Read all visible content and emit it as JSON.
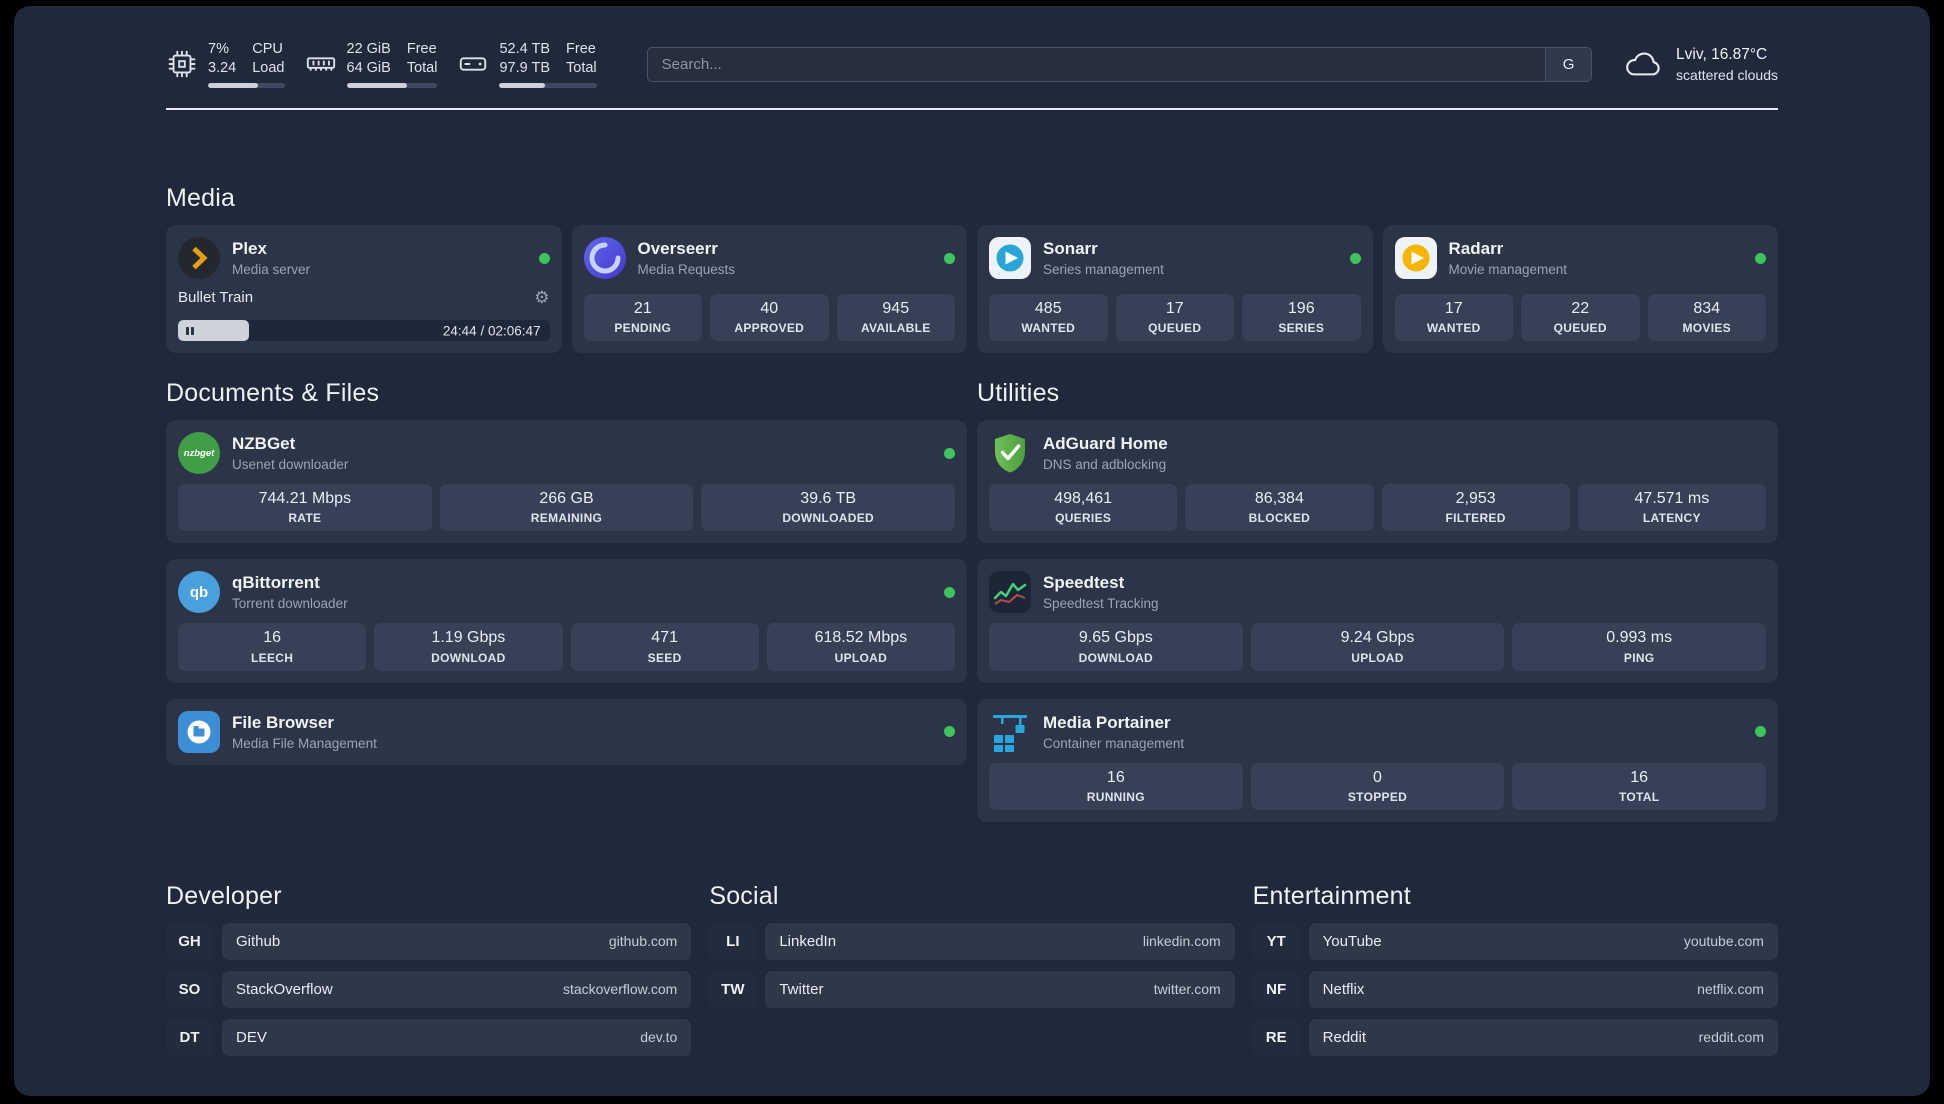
{
  "colors": {
    "status_online": "#3ec45c",
    "page_background": "#20293a",
    "card_background": "#2b3547",
    "plex_gold": "#e5a00d"
  },
  "icons": {
    "nzbget_glyph": "nzbget",
    "qbittorrent_glyph": "qb",
    "gear_glyph": "⚙"
  },
  "topbar": {
    "cpu": {
      "usage": "7%",
      "load": "3.24",
      "label_top": "CPU",
      "label_bottom": "Load",
      "bar_width": "65%"
    },
    "memory": {
      "free": "22 GiB",
      "total": "64 GiB",
      "label_top": "Free",
      "label_bottom": "Total",
      "bar_width": "66%"
    },
    "storage": {
      "free": "52.4 TB",
      "total": "97.9 TB",
      "label_top": "Free",
      "label_bottom": "Total",
      "bar_width": "47%"
    },
    "search": {
      "placeholder": "Search...",
      "engine_button": "G"
    },
    "weather": {
      "location": "Lviv, 16.87°C",
      "condition": "scattered clouds"
    }
  },
  "media": {
    "title": "Media",
    "plex": {
      "name": "Plex",
      "description": "Media server",
      "now_playing": "Bullet Train",
      "time": "24:44 / 02:06:47",
      "progress_width": "19%"
    },
    "overseerr": {
      "name": "Overseerr",
      "description": "Media Requests",
      "stats": [
        {
          "value": "21",
          "label": "PENDING"
        },
        {
          "value": "40",
          "label": "APPROVED"
        },
        {
          "value": "945",
          "label": "AVAILABLE"
        }
      ]
    },
    "sonarr": {
      "name": "Sonarr",
      "description": "Series management",
      "stats": [
        {
          "value": "485",
          "label": "WANTED"
        },
        {
          "value": "17",
          "label": "QUEUED"
        },
        {
          "value": "196",
          "label": "SERIES"
        }
      ]
    },
    "radarr": {
      "name": "Radarr",
      "description": "Movie management",
      "stats": [
        {
          "value": "17",
          "label": "WANTED"
        },
        {
          "value": "22",
          "label": "QUEUED"
        },
        {
          "value": "834",
          "label": "MOVIES"
        }
      ]
    }
  },
  "documents": {
    "title": "Documents & Files",
    "nzbget": {
      "name": "NZBGet",
      "description": "Usenet downloader",
      "stats": [
        {
          "value": "744.21 Mbps",
          "label": "RATE"
        },
        {
          "value": "266 GB",
          "label": "REMAINING"
        },
        {
          "value": "39.6 TB",
          "label": "DOWNLOADED"
        }
      ]
    },
    "qbittorrent": {
      "name": "qBittorrent",
      "description": "Torrent downloader",
      "stats": [
        {
          "value": "16",
          "label": "LEECH"
        },
        {
          "value": "1.19 Gbps",
          "label": "DOWNLOAD"
        },
        {
          "value": "471",
          "label": "SEED"
        },
        {
          "value": "618.52 Mbps",
          "label": "UPLOAD"
        }
      ]
    },
    "filebrowser": {
      "name": "File Browser",
      "description": "Media File Management"
    }
  },
  "utilities": {
    "title": "Utilities",
    "adguard": {
      "name": "AdGuard Home",
      "description": "DNS and adblocking",
      "stats": [
        {
          "value": "498,461",
          "label": "QUERIES"
        },
        {
          "value": "86,384",
          "label": "BLOCKED"
        },
        {
          "value": "2,953",
          "label": "FILTERED"
        },
        {
          "value": "47.571 ms",
          "label": "LATENCY"
        }
      ]
    },
    "speedtest": {
      "name": "Speedtest",
      "description": "Speedtest Tracking",
      "stats": [
        {
          "value": "9.65 Gbps",
          "label": "DOWNLOAD"
        },
        {
          "value": "9.24 Gbps",
          "label": "UPLOAD"
        },
        {
          "value": "0.993 ms",
          "label": "PING"
        }
      ]
    },
    "portainer": {
      "name": "Media Portainer",
      "description": "Container management",
      "stats": [
        {
          "value": "16",
          "label": "RUNNING"
        },
        {
          "value": "0",
          "label": "STOPPED"
        },
        {
          "value": "16",
          "label": "TOTAL"
        }
      ]
    }
  },
  "bookmarks": {
    "developer": {
      "title": "Developer",
      "items": [
        {
          "abbr": "GH",
          "name": "Github",
          "url": "github.com"
        },
        {
          "abbr": "SO",
          "name": "StackOverflow",
          "url": "stackoverflow.com"
        },
        {
          "abbr": "DT",
          "name": "DEV",
          "url": "dev.to"
        }
      ]
    },
    "social": {
      "title": "Social",
      "items": [
        {
          "abbr": "LI",
          "name": "LinkedIn",
          "url": "linkedin.com"
        },
        {
          "abbr": "TW",
          "name": "Twitter",
          "url": "twitter.com"
        }
      ]
    },
    "entertainment": {
      "title": "Entertainment",
      "items": [
        {
          "abbr": "YT",
          "name": "YouTube",
          "url": "youtube.com"
        },
        {
          "abbr": "NF",
          "name": "Netflix",
          "url": "netflix.com"
        },
        {
          "abbr": "RE",
          "name": "Reddit",
          "url": "reddit.com"
        }
      ]
    }
  }
}
